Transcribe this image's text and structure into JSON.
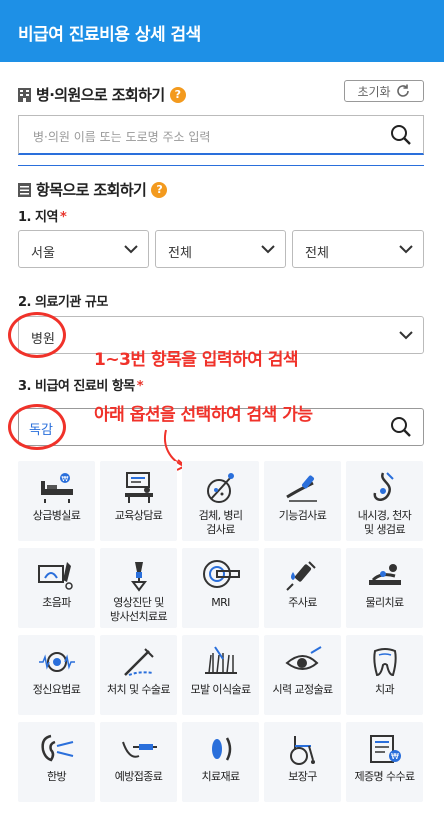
{
  "header": {
    "title": "비급여 진료비용 상세 검색"
  },
  "hospital_search": {
    "title": "병·의원으로 조회하기",
    "help": "?",
    "reset_label": "초기화",
    "placeholder": "병·의원 이름 또는 도로명 주소 입력"
  },
  "item_search": {
    "title": "항목으로 조회하기",
    "help": "?",
    "region_label": "1. 지역",
    "region_required": "*",
    "region_values": [
      "서울",
      "전체",
      "전체"
    ],
    "scale_label": "2. 의료기관 규모",
    "scale_value": "병원",
    "item_label": "3. 비급여 진료비 항목",
    "item_required": "*",
    "item_value": "독감"
  },
  "annotations": {
    "text1": "1~3번 항목을 입력하여 검색",
    "text2": "아래 옵션을 선택하여 검색 가능",
    "color": "#f0322a"
  },
  "categories": [
    {
      "label": "상급병실료",
      "icon": "hospital-bed-icon"
    },
    {
      "label": "교육상담료",
      "icon": "consultation-icon"
    },
    {
      "label": "검체, 병리\n검사료",
      "icon": "specimen-test-icon"
    },
    {
      "label": "기능검사료",
      "icon": "function-test-icon"
    },
    {
      "label": "내시경, 천자\n및 생검료",
      "icon": "endoscope-icon"
    },
    {
      "label": "초음파",
      "icon": "ultrasound-icon"
    },
    {
      "label": "영상진단 및\n방사선치료료",
      "icon": "radiology-icon"
    },
    {
      "label": "MRI",
      "icon": "mri-icon"
    },
    {
      "label": "주사료",
      "icon": "injection-icon"
    },
    {
      "label": "물리치료",
      "icon": "physical-therapy-icon"
    },
    {
      "label": "정신요법료",
      "icon": "brain-icon"
    },
    {
      "label": "처치 및 수술료",
      "icon": "surgery-icon"
    },
    {
      "label": "모발 이식술료",
      "icon": "hair-transplant-icon"
    },
    {
      "label": "시력 교정술료",
      "icon": "eye-icon"
    },
    {
      "label": "치과",
      "icon": "tooth-icon"
    },
    {
      "label": "한방",
      "icon": "acupuncture-icon"
    },
    {
      "label": "예방접종료",
      "icon": "vaccine-icon"
    },
    {
      "label": "치료재료",
      "icon": "capsule-icon"
    },
    {
      "label": "보장구",
      "icon": "wheelchair-icon"
    },
    {
      "label": "제증명 수수료",
      "icon": "certificate-icon"
    }
  ]
}
